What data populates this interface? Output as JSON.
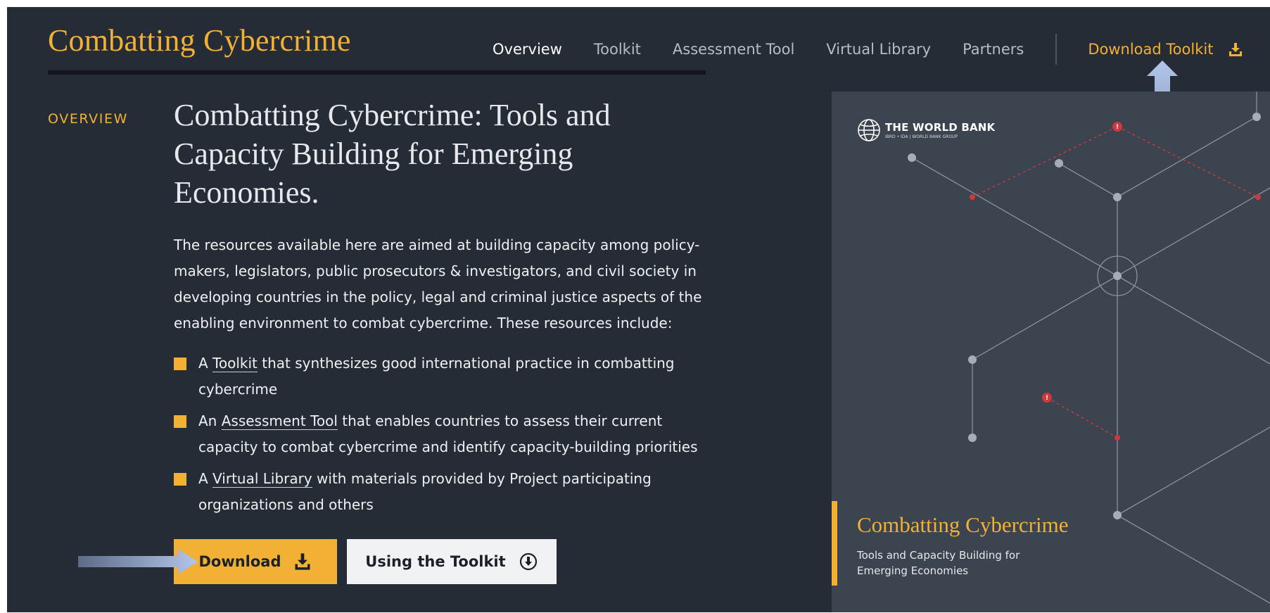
{
  "header": {
    "logo": "Combatting Cybercrime",
    "nav": [
      {
        "label": "Overview",
        "active": true
      },
      {
        "label": "Toolkit"
      },
      {
        "label": "Assessment Tool"
      },
      {
        "label": "Virtual Library"
      },
      {
        "label": "Partners"
      }
    ],
    "download_label": "Download Toolkit",
    "download_icon": "download-icon"
  },
  "section_label": "OVERVIEW",
  "headline": "Combatting Cybercrime: Tools and Capacity Building for Emerging Economies.",
  "intro": "The resources available here are aimed at building capacity among policy-makers, legislators, public prosecutors & investigators, and civil society in developing countries in the policy, legal and criminal justice aspects of the enabling environment to combat cybercrime. These resources include:",
  "bullets": [
    {
      "prefix": "A ",
      "link": "Toolkit",
      "suffix": " that synthesizes good international practice in combatting cybercrime"
    },
    {
      "prefix": "An ",
      "link": "Assessment Tool",
      "suffix": " that enables countries to assess their current capacity to combat cybercrime and identify capacity-building priorities"
    },
    {
      "prefix": "A ",
      "link": "Virtual Library",
      "suffix": " with materials provided by Project participating organizations and others"
    }
  ],
  "buttons": {
    "download": "Download",
    "download_icon": "download-icon",
    "toolkit": "Using the Toolkit",
    "toolkit_icon": "circle-arrow-down-icon"
  },
  "cover": {
    "org_name": "THE WORLD BANK",
    "org_sub": "IBRD • IDA | WORLD BANK GROUP",
    "title": "Combatting Cybercrime",
    "subtitle": "Tools and Capacity Building for Emerging Economies"
  },
  "colors": {
    "accent": "#f2b134",
    "background": "#262c36",
    "cover_background": "#3c444f",
    "alert_red": "#d0393c"
  }
}
